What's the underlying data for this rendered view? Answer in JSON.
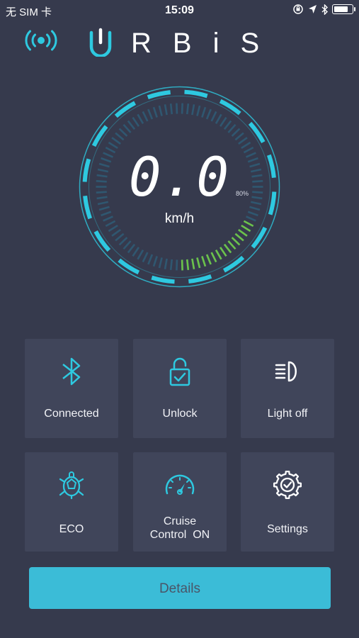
{
  "status_bar": {
    "carrier": "无 SIM 卡",
    "time": "15:09",
    "battery_level": 0.85
  },
  "brand": {
    "logo_text": "RBiS",
    "accent_color": "#2ec9e0",
    "logo_color": "#ffffff"
  },
  "speedometer": {
    "speed": "0.0",
    "unit": "km/h",
    "battery_percent": "80%",
    "battery_level": 0.8,
    "ring_color": "#2ec9e0",
    "battery_color": "#6cc24a"
  },
  "tiles": [
    {
      "label_lines": [
        "Connected"
      ],
      "icon": "bluetooth-icon"
    },
    {
      "label_lines": [
        "Unlock"
      ],
      "icon": "unlock-icon"
    },
    {
      "label_lines": [
        "Light off"
      ],
      "icon": "headlight-icon"
    },
    {
      "label_lines": [
        "ECO"
      ],
      "icon": "turtle-icon"
    },
    {
      "label_lines": [
        "Cruise",
        "Control  ON"
      ],
      "icon": "speedometer-icon"
    },
    {
      "label_lines": [
        "Settings"
      ],
      "icon": "gear-check-icon"
    }
  ],
  "details_button": {
    "label": "Details",
    "color": "#3bbcd7"
  }
}
